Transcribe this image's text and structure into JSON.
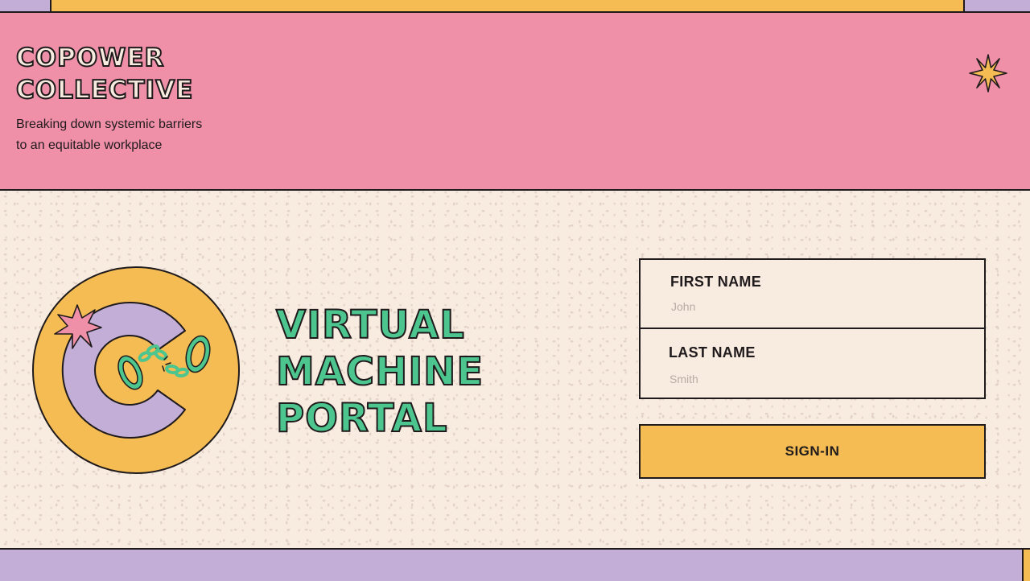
{
  "brand": {
    "title_line1": "COPOWER",
    "title_line2": "COLLECTIVE",
    "tagline_line1": "Breaking down systemic barriers",
    "tagline_line2": "to an equitable workplace",
    "star_icon": "sparkle-star-icon"
  },
  "hero": {
    "title_line1": "VIRTUAL",
    "title_line2": "MACHINE",
    "title_line3": "PORTAL",
    "logo_icon": "broken-chain-c-logo"
  },
  "form": {
    "first_name": {
      "label": "FIRST NAME",
      "placeholder": "John",
      "value": ""
    },
    "last_name": {
      "label": "LAST NAME",
      "placeholder": "Smith",
      "value": ""
    },
    "submit_label": "SIGN-IN"
  },
  "colors": {
    "pink": "#ef8fa8",
    "yellow": "#f4bc52",
    "lavender": "#c2aed6",
    "green": "#4cc58e",
    "cream": "#f8ebe0",
    "ink": "#1f1a1c"
  }
}
